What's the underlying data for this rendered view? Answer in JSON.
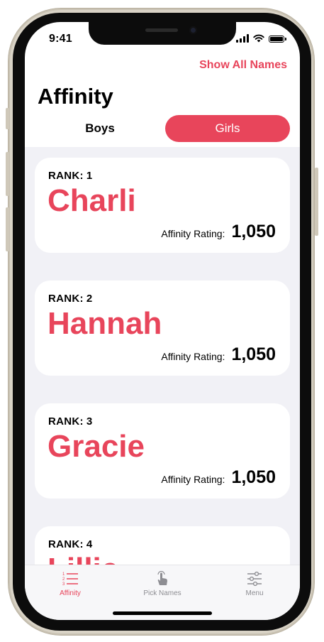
{
  "status_bar": {
    "time": "9:41"
  },
  "header": {
    "show_all_label": "Show All Names",
    "title": "Affinity"
  },
  "segmented": {
    "options": [
      "Boys",
      "Girls"
    ],
    "selected": "Girls"
  },
  "rank_label": "RANK:",
  "rating_label": "Affinity Rating:",
  "cards": [
    {
      "rank": "1",
      "name": "Charli",
      "rating": "1,050"
    },
    {
      "rank": "2",
      "name": "Hannah",
      "rating": "1,050"
    },
    {
      "rank": "3",
      "name": "Gracie",
      "rating": "1,050"
    },
    {
      "rank": "4",
      "name": "Lillie",
      "rating": ""
    }
  ],
  "tabbar": {
    "items": [
      {
        "label": "Affinity",
        "icon": "numbered-list-icon",
        "active": true
      },
      {
        "label": "Pick Names",
        "icon": "hand-tap-icon",
        "active": false
      },
      {
        "label": "Menu",
        "icon": "sliders-icon",
        "active": false
      }
    ]
  },
  "colors": {
    "accent": "#e8455b",
    "list_background": "#f1f1f6",
    "inactive_tab": "#8e8e93"
  }
}
